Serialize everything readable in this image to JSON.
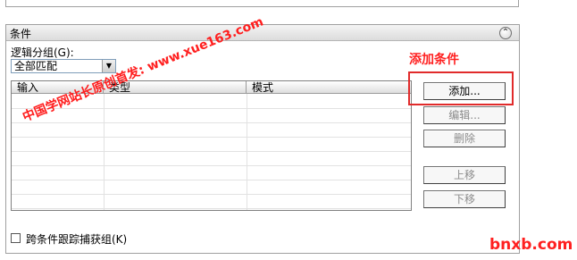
{
  "panel": {
    "title": "条件",
    "collapse_glyph": "⌃",
    "group_label": "逻辑分组(G):",
    "group_select": {
      "value": "全部匹配",
      "arrow": "▼"
    },
    "table": {
      "columns": [
        "输入",
        "类型",
        "模式"
      ],
      "rows": []
    },
    "buttons": {
      "add": "添加...",
      "edit": "编辑...",
      "delete": "删除",
      "move_up": "上移",
      "move_down": "下移"
    },
    "checkbox_label": "跨条件跟踪捕获组(K)"
  },
  "annotations": {
    "callout": "添加条件",
    "watermark": "中国学网站长原创首发: www.xue163.com",
    "corner_mark": "bnxb.com",
    "accent_color": "#ff2020"
  }
}
